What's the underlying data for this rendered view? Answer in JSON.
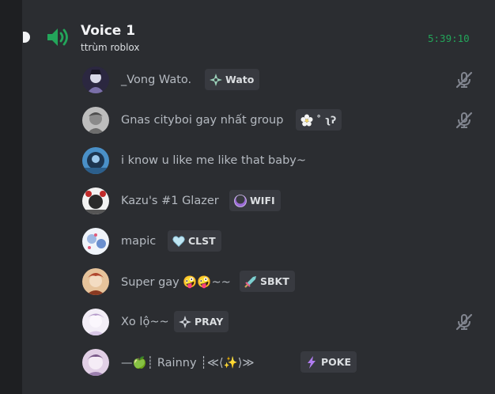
{
  "channel": {
    "name": "Voice 1",
    "status": "ttrùm roblox",
    "timer": "5:39:10"
  },
  "members": [
    {
      "name": "_Vong Wato.",
      "tag": "Wato",
      "tag_icon": "compass-diamond-icon",
      "tag_color": "#9ad0b8",
      "muted": true,
      "avatar_colors": [
        "#2b2740",
        "#7a6fa8"
      ]
    },
    {
      "name": "Gnas cityboi gay nhất group",
      "tag": "˚ ʅʔ",
      "tag_icon": "white-flower-icon",
      "tag_color": "#f4f4f4",
      "muted": true,
      "avatar_colors": [
        "#bdbdbd",
        "#6d6d6d"
      ]
    },
    {
      "name": "i know u like me like that baby~",
      "tag": "",
      "tag_icon": "",
      "muted": false,
      "avatar_colors": [
        "#4a90c8",
        "#1d3550"
      ]
    },
    {
      "name": "Kazu's #1 Glazer",
      "tag": "WIFI",
      "tag_icon": "purple-moon-icon",
      "tag_color": "#9b6bd6",
      "muted": false,
      "avatar_colors": [
        "#f2f2f2",
        "#c02a2a"
      ]
    },
    {
      "name": "mapic",
      "tag": "CLST",
      "tag_icon": "light-blue-heart-icon",
      "tag_color": "#bfe6f3",
      "muted": false,
      "avatar_colors": [
        "#f0f4fa",
        "#6a8fcf"
      ]
    },
    {
      "name": "Super gay 🤪🤪~~",
      "tag": "SBKT",
      "tag_icon": "sword-icon",
      "tag_color": "#7ccfd0",
      "muted": false,
      "avatar_colors": [
        "#e6c39b",
        "#b0462d"
      ]
    },
    {
      "name": "Xo lộ~~",
      "tag": "PRAY",
      "tag_icon": "compass-diamond-icon",
      "tag_color": "#cfd3d9",
      "muted": true,
      "avatar_colors": [
        "#f3eef7",
        "#b49ac9"
      ]
    },
    {
      "name": "—🍏┊  Rainny  ┊≪⟨✨⟩≫",
      "tag": "POKE",
      "tag_icon": "lightning-icon",
      "tag_color": "#b07cf0",
      "muted": false,
      "avatar_colors": [
        "#e2d0e6",
        "#7b5a8a"
      ]
    }
  ]
}
